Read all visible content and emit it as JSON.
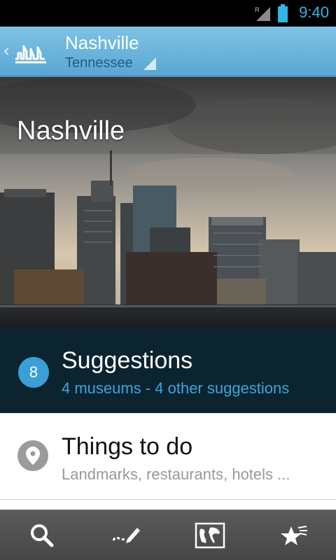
{
  "status_bar": {
    "time": "9:40",
    "roaming_indicator": "R",
    "icons": [
      "signal-icon",
      "battery-icon"
    ]
  },
  "action_bar": {
    "title": "Nashville",
    "subtitle": "Tennessee",
    "icons": [
      "up-caret-icon",
      "app-logo-icon",
      "spinner-triangle-icon"
    ]
  },
  "hero": {
    "title": "Nashville"
  },
  "suggestions": {
    "count": "8",
    "title": "Suggestions",
    "subtitle": "4 museums - 4 other suggestions"
  },
  "things_to_do": {
    "title": "Things to do",
    "subtitle": "Landmarks, restaurants, hotels ...",
    "icon": "map-pin-icon"
  },
  "bottom_bar": {
    "buttons": [
      "search-icon",
      "edit-icon",
      "map-icon",
      "favorites-icon"
    ]
  },
  "colors": {
    "accent": "#33b5e5",
    "action_bar": "#6fb6de",
    "suggestions_bg": "#0b2430",
    "suggestions_sub": "#3aa6dc",
    "bottom_bar": "#4f4f4f"
  }
}
